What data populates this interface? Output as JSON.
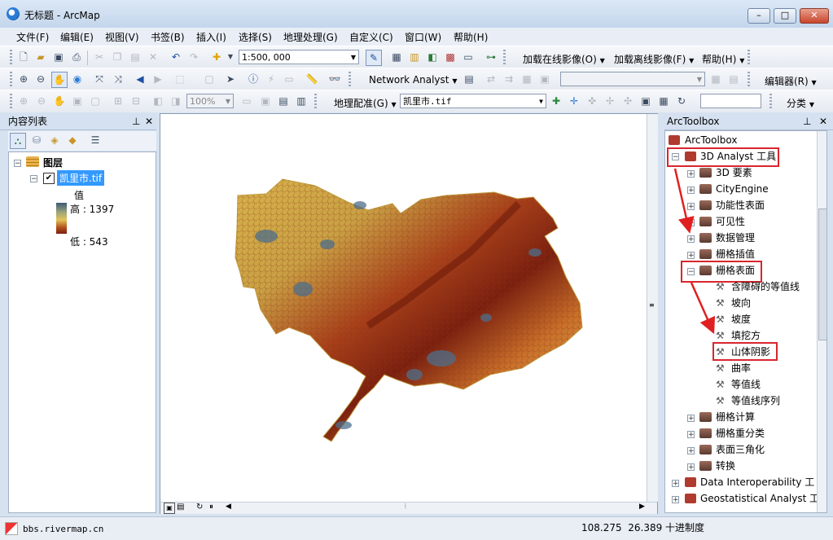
{
  "window": {
    "title": "无标题 - ArcMap",
    "buttons": {
      "minimize": "–",
      "maximize": "□",
      "close": "✕"
    }
  },
  "menu": [
    "文件(F)",
    "编辑(E)",
    "视图(V)",
    "书签(B)",
    "插入(I)",
    "选择(S)",
    "地理处理(G)",
    "自定义(C)",
    "窗口(W)",
    "帮助(H)"
  ],
  "toolbar1": {
    "scale": "1:500, 000",
    "online_imagery": "加载在线影像(O)",
    "offline_imagery": "加载离线影像(F)",
    "help": "帮助(H)"
  },
  "toolbar2": {
    "network_analyst": "Network Analyst",
    "editor": "编辑器(R)"
  },
  "toolbar3": {
    "zoom": "100%",
    "georef": "地理配准(G)",
    "georef_layer": "凯里市.tif",
    "classify": "分类"
  },
  "toc": {
    "title": "内容列表",
    "group": "图层",
    "layer": "凯里市.tif",
    "value_label": "值",
    "high": "高 : 1397",
    "low": "低 : 543",
    "pin": "⊥",
    "close": "✕"
  },
  "toolbox": {
    "title": "ArcToolbox",
    "root": "ArcToolbox",
    "items": [
      "3D Analyst 工具",
      "3D 要素",
      "CityEngine",
      "功能性表面",
      "可见性",
      "数据管理",
      "栅格插值",
      "栅格表面",
      "含障碍的等值线",
      "坡向",
      "坡度",
      "填挖方",
      "山体阴影",
      "曲率",
      "等值线",
      "等值线序列",
      "栅格计算",
      "栅格重分类",
      "表面三角化",
      "转换",
      "Data Interoperability 工",
      "Geostatistical Analyst 工"
    ]
  },
  "statusbar": {
    "coords": "108.275  26.389 十进制度",
    "watermark": "bbs.rivermap.cn"
  },
  "colors": {
    "dem_high": "#7a1f0f",
    "dem_mid": "#e2c35a",
    "dem_low": "#3d5b78",
    "highlight": "#d9262e"
  }
}
